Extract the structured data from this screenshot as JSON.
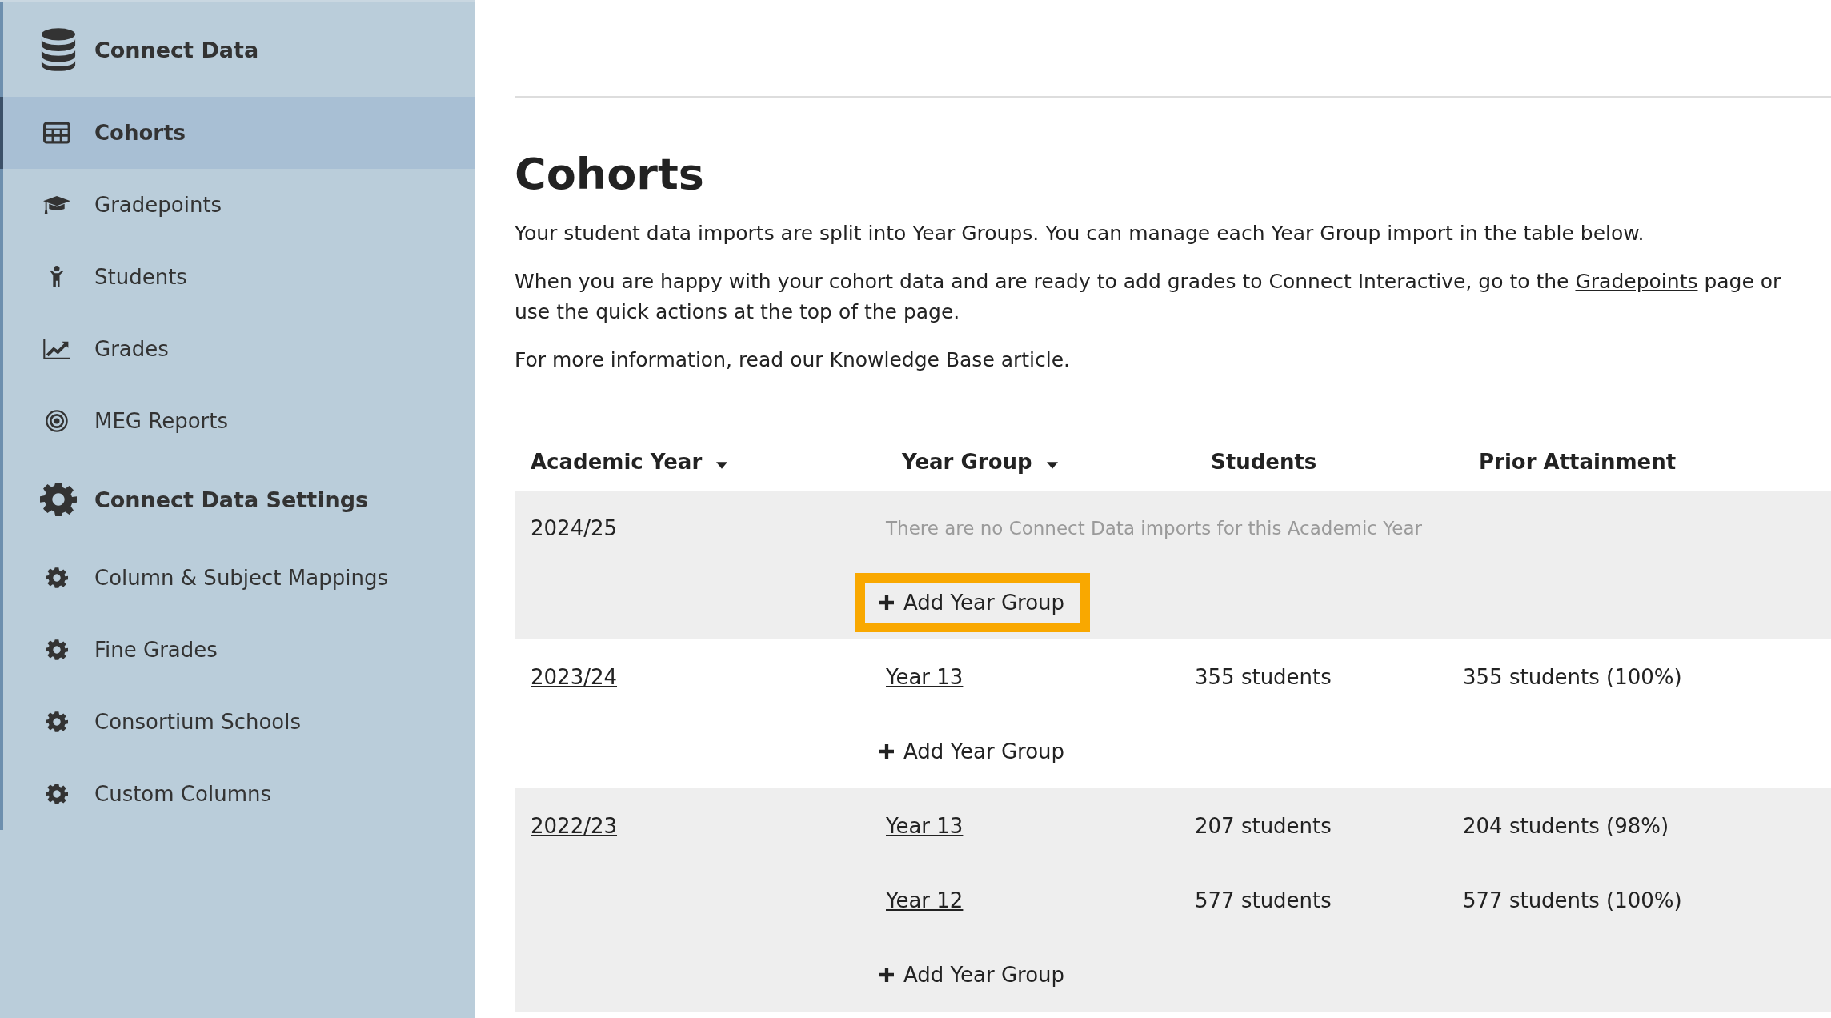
{
  "sidebar": {
    "header": {
      "label": "Connect Data"
    },
    "items": [
      {
        "label": "Cohorts",
        "selected": true
      },
      {
        "label": "Gradepoints",
        "selected": false
      },
      {
        "label": "Students",
        "selected": false
      },
      {
        "label": "Grades",
        "selected": false
      },
      {
        "label": "MEG Reports",
        "selected": false
      }
    ],
    "settings": {
      "label": "Connect Data Settings",
      "items": [
        {
          "label": "Column & Subject Mappings",
          "selected": false
        },
        {
          "label": "Fine Grades",
          "selected": false
        },
        {
          "label": "Consortium Schools",
          "selected": false
        },
        {
          "label": "Custom Columns",
          "selected": false
        }
      ]
    }
  },
  "page": {
    "title": "Cohorts",
    "intro": "Your student data imports are split into Year Groups. You can manage each Year Group import in the table below.",
    "quick_actions": {
      "before": "When you are happy with your cohort data and are ready to add grades to Connect Interactive, go to the ",
      "link": "Gradepoints",
      "after": " page or use the quick actions at the top of the page."
    },
    "more_info": "For more information, read our Knowledge Base article."
  },
  "table": {
    "columns": [
      {
        "label": "Academic Year",
        "sortable": true
      },
      {
        "label": "Year Group",
        "sortable": true
      },
      {
        "label": "Students",
        "sortable": false
      },
      {
        "label": "Prior Attainment",
        "sortable": false
      }
    ],
    "rows": [
      {
        "year": "2024/25",
        "link": false,
        "empty_message": "There are no Connect Data imports for this Academic Year",
        "groups": [],
        "add_button": {
          "label": "Add Year Group",
          "highlighted": true
        }
      },
      {
        "year": "2023/24",
        "link": true,
        "groups": [
          {
            "name": "Year 13",
            "students": "355 students",
            "prior": "355 students (100%)"
          }
        ],
        "add_button": {
          "label": "Add Year Group",
          "highlighted": false
        }
      },
      {
        "year": "2022/23",
        "link": true,
        "groups": [
          {
            "name": "Year 13",
            "students": "207 students",
            "prior": "204 students (98%)"
          },
          {
            "name": "Year 12",
            "students": "577 students",
            "prior": "577 students (100%)"
          }
        ],
        "add_button": {
          "label": "Add Year Group",
          "highlighted": false
        }
      }
    ]
  }
}
